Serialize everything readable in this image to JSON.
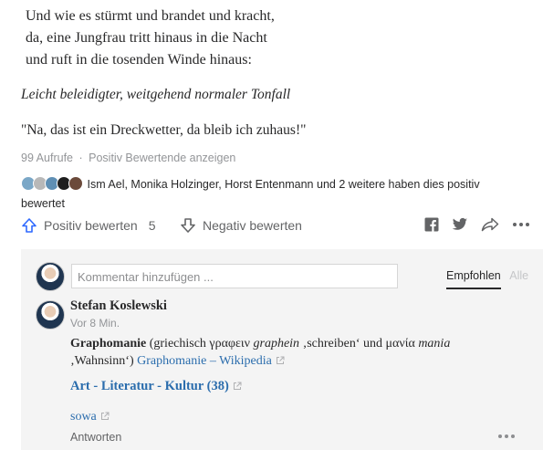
{
  "poem": {
    "lines": [
      "Und wie es stürmt und brandet und kracht,",
      "da, eine Jungfrau tritt hinaus in die Nacht",
      "und ruft in die tosenden Winde hinaus:"
    ],
    "italic_line": "Leicht beleidigter, weitgehend normaler Tonfall",
    "quote_line": "\"Na, das ist ein Dreckwetter, da bleib ich zuhaus!\""
  },
  "stats": {
    "views": "99 Aufrufe",
    "separator": "·",
    "upvoters_link": "Positiv Bewertende anzeigen",
    "upvoters_text": "Ism Ael, Monika Holzinger, Horst Entenmann und 2 weitere haben dies positiv bewertet",
    "avatar_colors": [
      "#7aa7c7",
      "#b8b8b8",
      "#5f8fb4",
      "#1e1e1e",
      "#6b4a3a"
    ]
  },
  "actions": {
    "upvote_label": "Positiv bewerten",
    "upvote_count": "5",
    "downvote_label": "Negativ bewerten",
    "share_icons": [
      "facebook-icon",
      "twitter-icon",
      "share-icon",
      "more-icon"
    ]
  },
  "comments": {
    "input_placeholder": "Kommentar hinzufügen ...",
    "sort_active": "Empfohlen",
    "sort_inactive": "Alle",
    "items": [
      {
        "author": "Stefan Koslewski",
        "time": "Vor 8 Min.",
        "title_bold": "Graphomanie",
        "text_part1": " (griechisch γραφειν ",
        "text_italic1": "graphein",
        "text_part2": " ‚schreiben‘ und μανία ",
        "text_italic2": "mania",
        "text_part3": " ‚Wahnsinn‘) ",
        "link1": "Graphomanie – Wikipedia",
        "link2": "Art - Literatur - Kultur (38)",
        "link3": "sowa",
        "reply_label": "Antworten"
      }
    ]
  },
  "colors": {
    "link": "#2b6dad",
    "muted": "#939598",
    "comment_bg": "#f4f4f4"
  }
}
